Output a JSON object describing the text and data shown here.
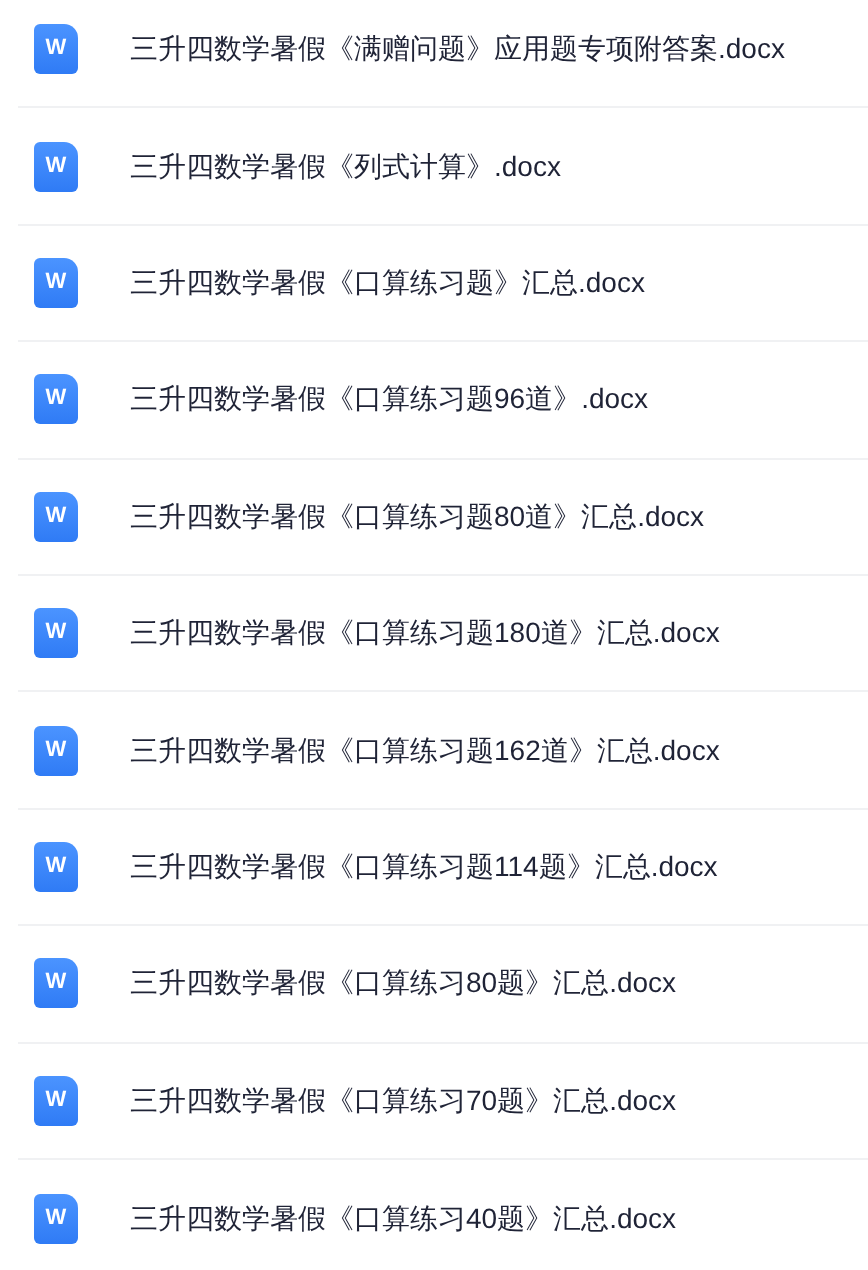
{
  "files": [
    {
      "name": "三升四数学暑假《满赠问题》应用题专项附答案.docx",
      "icon_letter": "W"
    },
    {
      "name": "三升四数学暑假《列式计算》.docx",
      "icon_letter": "W"
    },
    {
      "name": "三升四数学暑假《口算练习题》汇总.docx",
      "icon_letter": "W"
    },
    {
      "name": "三升四数学暑假《口算练习题96道》.docx",
      "icon_letter": "W"
    },
    {
      "name": "三升四数学暑假《口算练习题80道》汇总.docx",
      "icon_letter": "W"
    },
    {
      "name": "三升四数学暑假《口算练习题180道》汇总.docx",
      "icon_letter": "W"
    },
    {
      "name": "三升四数学暑假《口算练习题162道》汇总.docx",
      "icon_letter": "W"
    },
    {
      "name": "三升四数学暑假《口算练习题114题》汇总.docx",
      "icon_letter": "W"
    },
    {
      "name": "三升四数学暑假《口算练习80题》汇总.docx",
      "icon_letter": "W"
    },
    {
      "name": "三升四数学暑假《口算练习70题》汇总.docx",
      "icon_letter": "W"
    },
    {
      "name": "三升四数学暑假《口算练习40题》汇总.docx",
      "icon_letter": "W"
    }
  ]
}
